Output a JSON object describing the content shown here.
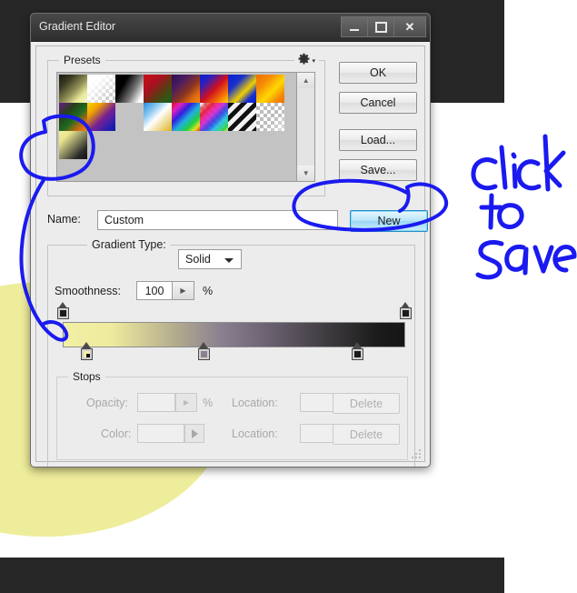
{
  "window": {
    "title": "Gradient Editor",
    "controls": {
      "minimize": "minimize-icon",
      "maximize": "maximize-icon",
      "close": "close-icon"
    }
  },
  "presets": {
    "group_label": "Presets",
    "gear_icon": "gear-icon",
    "scroll_up_icon": "triangle-up-icon",
    "scroll_down_icon": "triangle-down-icon",
    "swatches": [
      "black-yellow-gradient",
      "white-transparent-checker",
      "black-white-gradient",
      "red-green-gradient",
      "violet-orange-gradient",
      "blue-red-yellow-gradient",
      "blue-yellow-gradient",
      "orange-yellow-gradient",
      "violet-green-orange-gradient",
      "yellow-violet-blue-gradient",
      "copper-gradient",
      "blue-white-gold-gradient",
      "spectrum-gradient",
      "transparent-rainbow-gradient",
      "black-stripes-gradient",
      "checker-fade-gradient",
      "yellow-black-gradient"
    ]
  },
  "buttons": {
    "ok": "OK",
    "cancel": "Cancel",
    "load": "Load...",
    "save": "Save...",
    "new": "New"
  },
  "name_row": {
    "label": "Name:",
    "value": "Custom",
    "placeholder": ""
  },
  "gradient": {
    "type_label": "Gradient Type:",
    "type_value": "Solid",
    "type_caret_icon": "chevron-down-icon",
    "smoothness_label": "Smoothness:",
    "smoothness_value": "100",
    "smoothness_unit": "%",
    "smoothness_spin_icon": "triangle-right-icon",
    "strip_css": "linear-gradient(to right, #f2f0a4 0%, #eeeb9e 14%, #b6ae8e 32%, #8a8190 46%, #6f6676 58%, #3d3a3e 78%, #1b1b1b 92%, #161616 100%)",
    "opacity_stops": [
      {
        "name": "opacity-stop-start",
        "position_pct": 0,
        "fill": "#1b1b1b"
      },
      {
        "name": "opacity-stop-end",
        "position_pct": 100,
        "fill": "#1b1b1b"
      }
    ],
    "color_stops": [
      {
        "name": "color-stop-1",
        "position_pct": 7,
        "fill": "#f2f0a4",
        "selected": true
      },
      {
        "name": "color-stop-2",
        "position_pct": 41,
        "fill": "#8a8190",
        "selected": false
      },
      {
        "name": "color-stop-3",
        "position_pct": 86,
        "fill": "#1b1b1b",
        "selected": false
      }
    ]
  },
  "stops": {
    "group_label": "Stops",
    "opacity_label": "Opacity:",
    "opacity_value": "",
    "opacity_unit": "%",
    "opacity_location_label": "Location:",
    "opacity_location_value": "",
    "opacity_location_unit": "%",
    "opacity_delete": "Delete",
    "color_label": "Color:",
    "color_value": "",
    "color_caret_icon": "triangle-right-icon",
    "color_location_label": "Location:",
    "color_location_value": "",
    "color_location_unit": "%",
    "color_delete": "Delete",
    "disabled": true
  },
  "annotation": {
    "text_line1": "click",
    "text_line2": "to",
    "text_line3": "save",
    "ink_color": "#1a1af0",
    "shapes": [
      "circle-around-selected-preset",
      "arrow-line-to-gradient-strip",
      "circle-around-new-button"
    ]
  },
  "background": {
    "dark_color": "#272727",
    "accent_circle_color": "#eeed9b",
    "page_color": "#ffffff"
  }
}
